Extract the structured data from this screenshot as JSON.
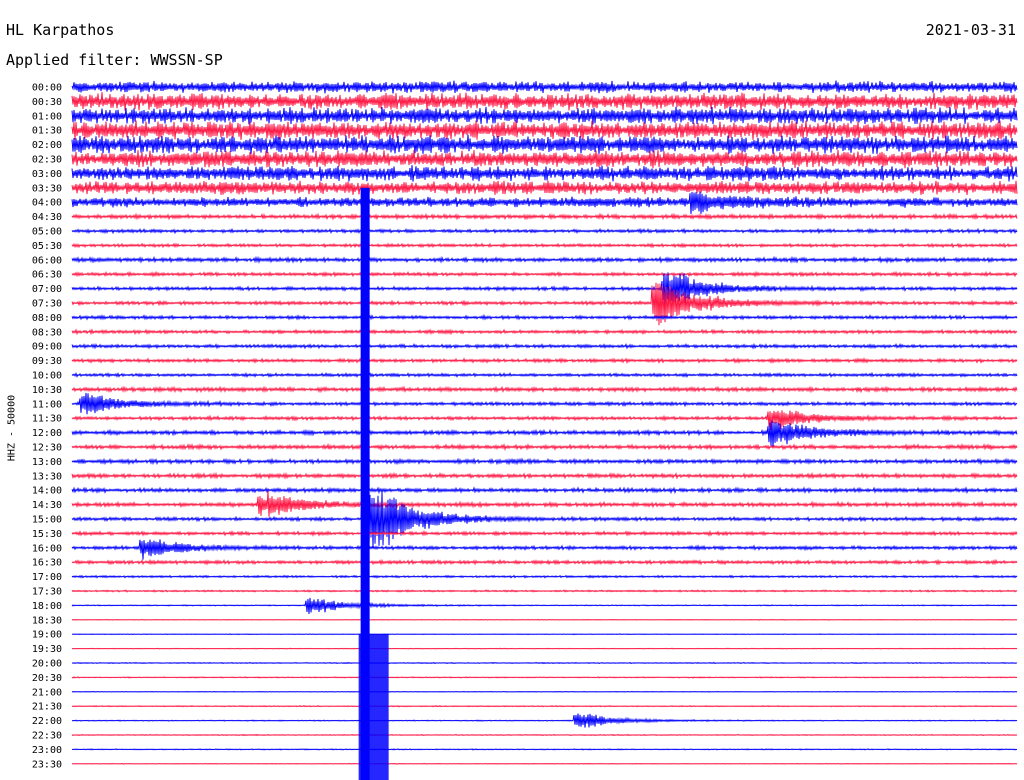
{
  "header": {
    "station": "HL Karpathos",
    "filter": "Applied filter: WWSSN-SP",
    "date": "2021-03-31"
  },
  "chart_data": {
    "type": "line",
    "title": "HL Karpathos",
    "subtitle": "Applied filter: WWSSN-SP",
    "date": "2021-03-31",
    "ylabel": "HHZ - 50000",
    "xlabel": "",
    "y_tick_labels": [
      "00:00",
      "00:30",
      "01:00",
      "01:30",
      "02:00",
      "02:30",
      "03:00",
      "03:30",
      "04:00",
      "04:30",
      "05:00",
      "05:30",
      "06:00",
      "06:30",
      "07:00",
      "07:30",
      "08:00",
      "08:30",
      "09:00",
      "09:30",
      "10:00",
      "10:30",
      "11:00",
      "11:30",
      "12:00",
      "12:30",
      "13:00",
      "13:30",
      "14:00",
      "14:30",
      "15:00",
      "15:30",
      "16:00",
      "16:30",
      "17:00",
      "17:30",
      "18:00",
      "18:30",
      "19:00",
      "19:30",
      "20:00",
      "20:30",
      "21:00",
      "21:30",
      "22:00",
      "22:30",
      "23:00",
      "23:30"
    ],
    "trace_colors": [
      "#0000ff",
      "#ff1744"
    ],
    "trace_minutes": 30,
    "noise_by_trace": [
      0.35,
      0.5,
      0.5,
      0.55,
      0.55,
      0.5,
      0.45,
      0.4,
      0.3,
      0.12,
      0.1,
      0.09,
      0.12,
      0.1,
      0.1,
      0.1,
      0.1,
      0.1,
      0.1,
      0.1,
      0.09,
      0.12,
      0.1,
      0.1,
      0.12,
      0.12,
      0.12,
      0.12,
      0.12,
      0.12,
      0.1,
      0.1,
      0.1,
      0.1,
      0.06,
      0.05,
      0.03,
      0.02,
      0.02,
      0.02,
      0.03,
      0.03,
      0.02,
      0.03,
      0.03,
      0.03,
      0.03,
      0.02
    ],
    "events": [
      {
        "trace": 30,
        "minute": 9.3,
        "amplitude": 1
      },
      {
        "trace": 15,
        "minute": 18.5,
        "amplitude": 0.6
      },
      {
        "trace": 14,
        "minute": 18.8,
        "amplitude": 0.5
      },
      {
        "trace": 8,
        "minute": 19.7,
        "amplitude": 0.25
      },
      {
        "trace": 24,
        "minute": 22.2,
        "amplitude": 0.35
      },
      {
        "trace": 23,
        "minute": 22.2,
        "amplitude": 0.25
      },
      {
        "trace": 22,
        "minute": 0.3,
        "amplitude": 0.3
      },
      {
        "trace": 29,
        "minute": 6.0,
        "amplitude": 0.3
      },
      {
        "trace": 32,
        "minute": 2.2,
        "amplitude": 0.25
      },
      {
        "trace": 36,
        "minute": 7.5,
        "amplitude": 0.2
      },
      {
        "trace": 44,
        "minute": 16.0,
        "amplitude": 0.2
      }
    ]
  }
}
